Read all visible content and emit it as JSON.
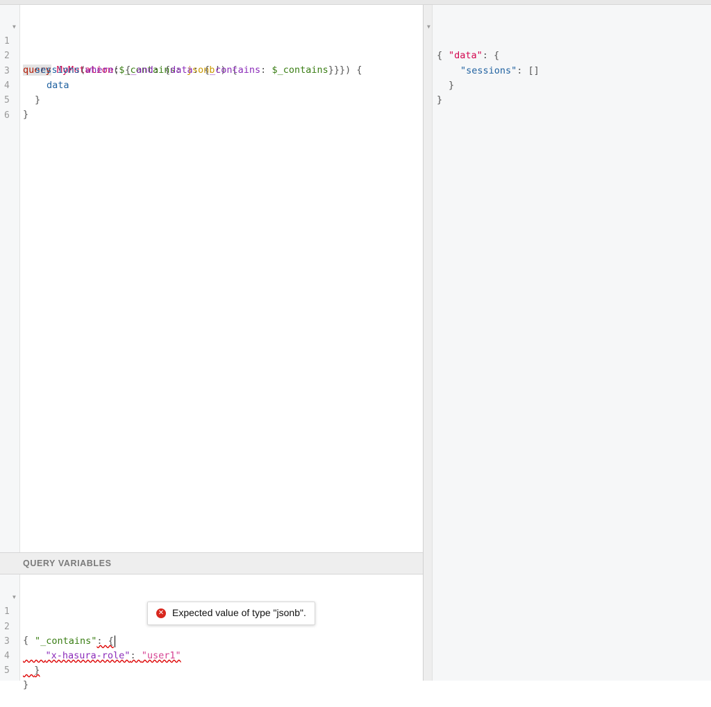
{
  "query_editor": {
    "lines": [
      {
        "n": "1",
        "kw": "query",
        "name": " MyMutation",
        "p1": "(",
        "var": "$_contains",
        "p2": ": ",
        "type": "jsonb",
        "p3": "!) {"
      },
      {
        "n": "2",
        "field": "sessions",
        "p1": "(",
        "arg": "where",
        "p2": ": {",
        "arg2": "_and",
        "p3": ": {",
        "arg3": "data",
        "p4": ": {",
        "arg4": "_contains",
        "p5": ": ",
        "var": "$_contains",
        "p6": "}}}) {"
      },
      {
        "n": "3",
        "field": "data"
      },
      {
        "n": "4",
        "text": "}"
      },
      {
        "n": "5",
        "text": "}"
      },
      {
        "n": "6",
        "text": ""
      }
    ]
  },
  "result": {
    "l1": "{",
    "l2_key": "\"data\"",
    "l2_rest": ": {",
    "l3_key": "\"sessions\"",
    "l3_rest": ": []",
    "l4": "}",
    "l5": "}"
  },
  "variables": {
    "title": "QUERY VARIABLES",
    "lines": [
      {
        "n": "1",
        "text": "{"
      },
      {
        "n": "2",
        "key": "\"_contains\"",
        "rest": ": {"
      },
      {
        "n": "3",
        "key": "\"x-hasura-role\"",
        "rest": ": ",
        "value": "\"user1\""
      },
      {
        "n": "4",
        "text": "}"
      },
      {
        "n": "5",
        "text": "}"
      }
    ]
  },
  "tooltip": {
    "icon": "error-icon",
    "message": "Expected value of type \"jsonb\"."
  }
}
